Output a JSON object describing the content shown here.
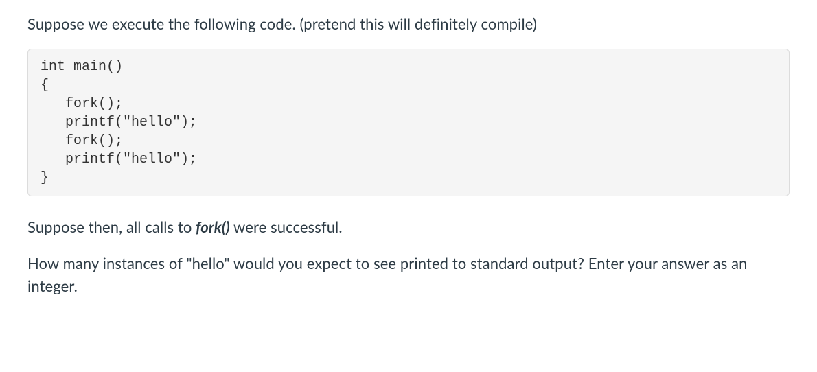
{
  "question": {
    "intro": "Suppose we execute the following code. (pretend this will definitely compile)",
    "code_lines": [
      "int main()",
      "{",
      "   fork();",
      "   printf(\"hello\");",
      "   fork();",
      "   printf(\"hello\");",
      "}"
    ],
    "assumption_pre": "Suppose then, all calls to ",
    "assumption_fork": "fork()",
    "assumption_post": " were successful.",
    "prompt": "How many instances of \"hello\" would you expect to see printed to standard output? Enter your answer as an integer."
  }
}
